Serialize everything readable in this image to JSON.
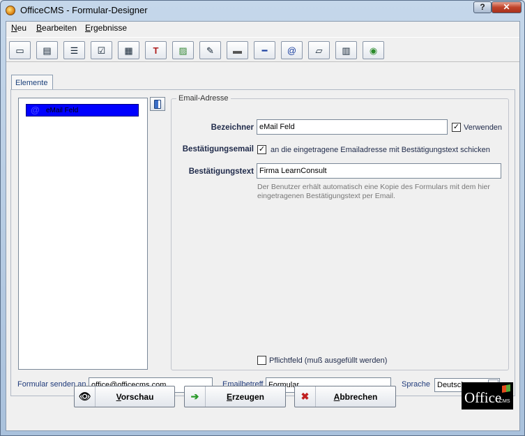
{
  "window": {
    "title": "OfficeCMS - Formular-Designer",
    "help_label": "?",
    "close_label": "✕"
  },
  "menu": [
    {
      "label": "Neu"
    },
    {
      "label": "Bearbeiten"
    },
    {
      "label": "Ergebnisse"
    }
  ],
  "toolbar": {
    "icons": [
      "textfield-icon",
      "textarea-icon",
      "list-icon",
      "checkbox-icon",
      "table-icon",
      "text-format-icon",
      "image-icon",
      "script-icon",
      "panel-icon",
      "separator-icon",
      "email-icon",
      "page-icon",
      "layers-icon",
      "globe-icon"
    ],
    "glyphs": [
      "▭",
      "▤",
      "☰",
      "☑",
      "▦",
      "T",
      "▨",
      "✎",
      "▬",
      "━",
      "@",
      "▱",
      "▥",
      "◉"
    ]
  },
  "tab": {
    "label": "Elemente"
  },
  "elements_list": {
    "items": [
      {
        "icon": "@",
        "label": "eMail Feld"
      }
    ]
  },
  "groupbox": {
    "legend": "Email-Adresse",
    "bezeichner_label": "Bezeichner",
    "bezeichner_value": "eMail Feld",
    "verwenden_label": "Verwenden",
    "verwenden_checked": "✓",
    "bestaetigungsemail_label": "Bestätigungsemail",
    "bestaetigungsemail_checked": "✓",
    "bestaetigungsemail_text": "an die eingetragene Emailadresse mit Bestätigungstext schicken",
    "bestaetigungstext_label": "Bestätigungstext",
    "bestaetigungstext_value": "Firma LearnConsult",
    "hint": "Der Benutzer erhält automatisch eine Kopie des Formulars mit dem hier eingetragenen Bestätigungstext per Email.",
    "pflichtfeld_label": "Pflichtfeld (muß ausgefüllt werden)",
    "pflichtfeld_checked": ""
  },
  "bottom": {
    "send_label": "Formular senden an",
    "send_value": "office@officecms.com",
    "subject_label": "Emailbetreff",
    "subject_value": "Formular",
    "language_label": "Sprache",
    "language_value": "Deutsch"
  },
  "footer": {
    "preview_label": "Vorschau",
    "generate_label": "Erzeugen",
    "cancel_label": "Abbrechen"
  },
  "logo": {
    "main": "Office",
    "sub": "CMS"
  },
  "colors": {
    "selection": "#0000ff",
    "label_text": "#1f2a4a"
  }
}
